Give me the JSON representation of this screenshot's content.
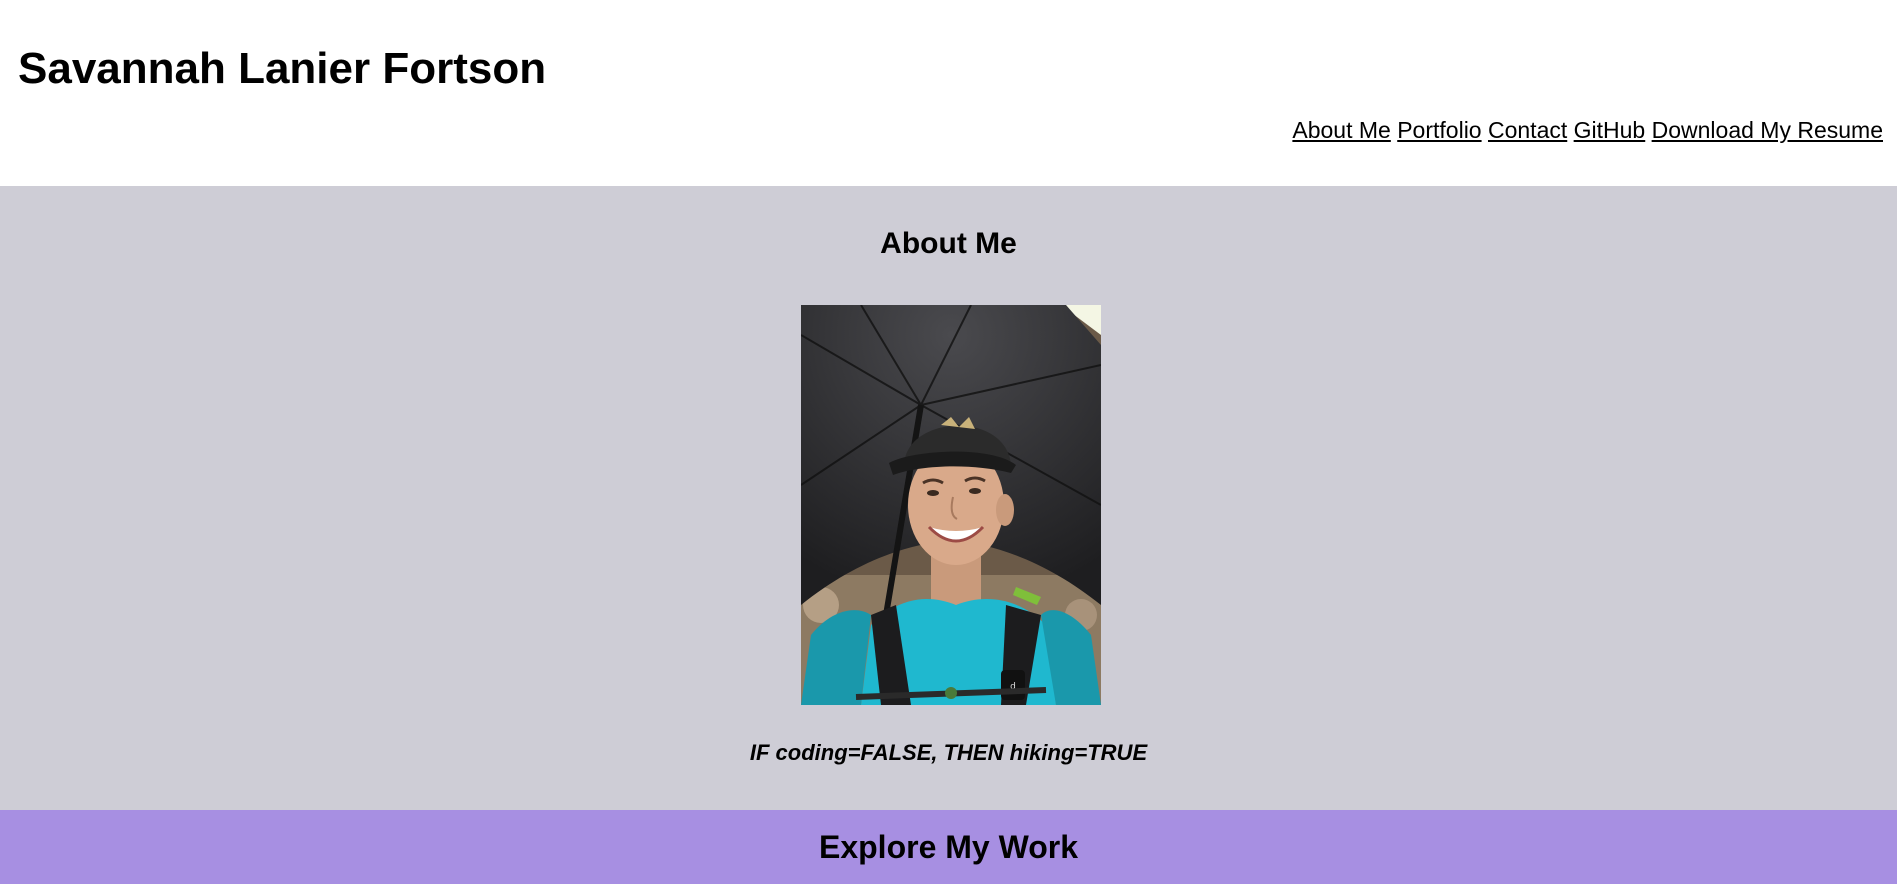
{
  "header": {
    "title": "Savannah Lanier Fortson",
    "nav": [
      {
        "label": "About Me"
      },
      {
        "label": "Portfolio"
      },
      {
        "label": "Contact"
      },
      {
        "label": "GitHub"
      },
      {
        "label": "Download My Resume"
      }
    ]
  },
  "about": {
    "heading": "About Me",
    "photo": {
      "semantic": "profile-photo",
      "description_icon": "photo-icon"
    },
    "tagline": "IF coding=FALSE, THEN hiking=TRUE"
  },
  "work": {
    "heading": "Explore My Work"
  },
  "colors": {
    "header_bg": "#ffffff",
    "about_bg": "#cecdd6",
    "work_bg": "#a78fe2"
  }
}
